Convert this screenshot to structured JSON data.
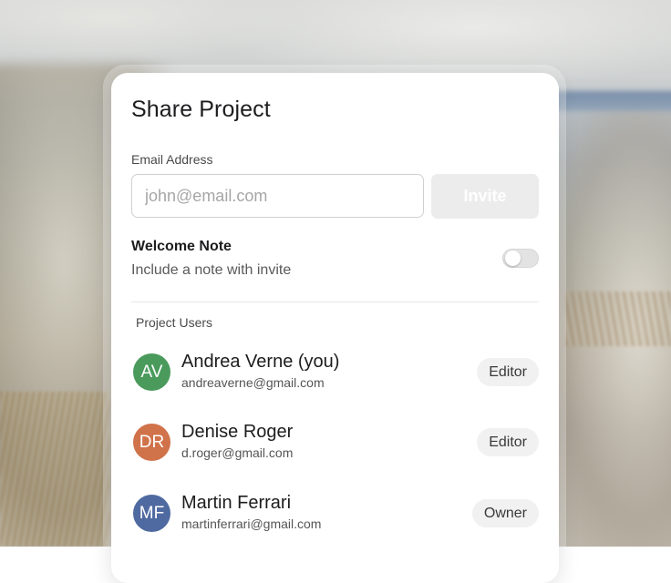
{
  "dialog": {
    "title": "Share Project",
    "email_label": "Email Address",
    "email_placeholder": "john@email.com",
    "email_value": "",
    "invite_label": "Invite",
    "welcome_note": {
      "title": "Welcome Note",
      "description": "Include a note with invite",
      "enabled": false
    },
    "users_label": "Project Users",
    "users": [
      {
        "initials": "AV",
        "name": "Andrea Verne (you)",
        "email": "andreaverne@gmail.com",
        "role": "Editor",
        "avatar_color": "#4a9a5c"
      },
      {
        "initials": "DR",
        "name": "Denise Roger",
        "email": "d.roger@gmail.com",
        "role": "Editor",
        "avatar_color": "#d0724a"
      },
      {
        "initials": "MF",
        "name": "Martin Ferrari",
        "email": "martinferrari@gmail.com",
        "role": "Owner",
        "avatar_color": "#4f6aa1"
      }
    ]
  },
  "colors": {
    "invite_disabled_bg": "#ececec",
    "badge_bg": "#f1f1f1",
    "divider": "#e6e6e6"
  }
}
